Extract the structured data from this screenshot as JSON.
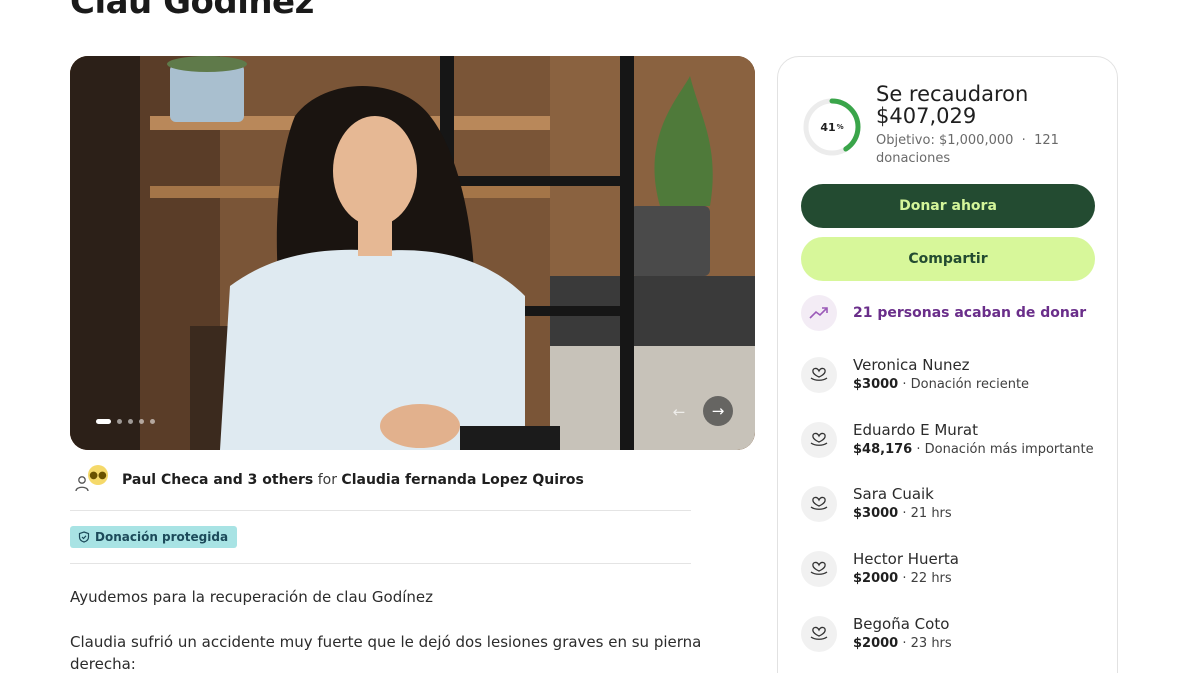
{
  "page": {
    "title": "Clau Godínez"
  },
  "hero": {
    "carousel_dots": 5,
    "active_dot": 0,
    "prev_icon": "arrow-left-icon",
    "next_icon": "arrow-right-icon"
  },
  "organizer": {
    "names": "Paul Checa and 3 others",
    "for_word": "for",
    "beneficiary": "Claudia fernanda Lopez Quiros"
  },
  "protected_badge": {
    "label": "Donación protegida",
    "color": "#a8e3e4"
  },
  "story": {
    "paragraph_1": "Ayudemos para la recuperación de clau Godínez",
    "paragraph_2_line_1": "Claudia sufrió un accidente muy fuerte que le dejó dos lesiones graves en su pierna",
    "paragraph_2_line_2": "derecha:"
  },
  "sidebar": {
    "progress_percent": 41,
    "progress_label": "41",
    "progress_unit": "%",
    "raised_title": "Se recaudaron",
    "raised_amount": "$407,029",
    "goal_text": "Objetivo: $1,000,000",
    "separator": "·",
    "donations_count_line_1": "121",
    "donations_count_line_2": "donaciones",
    "donate_button": "Donar ahora",
    "share_button": "Compartir",
    "recent_text": "21 personas acaban de donar",
    "accent_dark": "#234b31",
    "accent_light": "#d7f79a",
    "accent_purple": "#6a2e8a",
    "donors": [
      {
        "name": "Veronica Nunez",
        "amount": "$3000",
        "detail": "Donación reciente"
      },
      {
        "name": "Eduardo E Murat",
        "amount": "$48,176",
        "detail": "Donación más importante"
      },
      {
        "name": "Sara Cuaik",
        "amount": "$3000",
        "detail": "21 hrs"
      },
      {
        "name": "Hector Huerta",
        "amount": "$2000",
        "detail": "22 hrs"
      },
      {
        "name": "Begoña Coto",
        "amount": "$2000",
        "detail": "23 hrs"
      }
    ]
  }
}
